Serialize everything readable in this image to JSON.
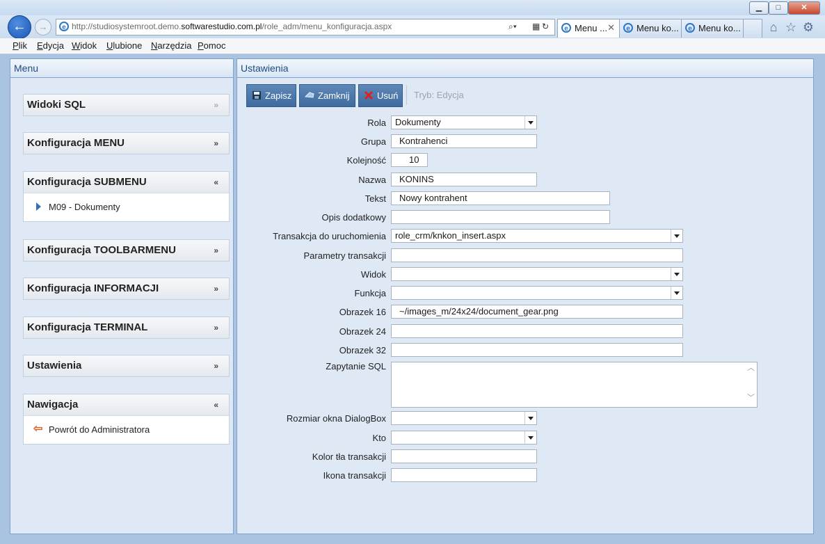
{
  "browser": {
    "url_prefix": "http://studiosystemroot.demo.",
    "url_domain": "softwarestudio.com.pl",
    "url_path": "/role_adm/menu_konfiguracja.aspx",
    "search_icon": "search-icon",
    "tabs": [
      {
        "label": "Menu ...",
        "active": true
      },
      {
        "label": "Menu ko...",
        "active": false
      },
      {
        "label": "Menu ko...",
        "active": false
      }
    ],
    "close_glyph": "✕",
    "titlebar_buttons": {
      "minimize": "▁",
      "maximize": "□",
      "close": "✕"
    }
  },
  "menubar": [
    "Plik",
    "Edycja",
    "Widok",
    "Ulubione",
    "Narzędzia",
    "Pomoc"
  ],
  "sidebar": {
    "title": "Menu",
    "sections": [
      {
        "title": "Widoki SQL",
        "expanded": false,
        "dim": true
      },
      {
        "title": "Konfiguracja MENU",
        "expanded": false
      },
      {
        "title": "Konfiguracja SUBMENU",
        "expanded": true,
        "item": "M09 - Dokumenty"
      },
      {
        "title": "Konfiguracja TOOLBARMENU",
        "expanded": false
      },
      {
        "title": "Konfiguracja INFORMACJI",
        "expanded": false
      },
      {
        "title": "Konfiguracja TERMINAL",
        "expanded": false
      },
      {
        "title": "Ustawienia",
        "expanded": false
      },
      {
        "title": "Nawigacja",
        "expanded": true,
        "item": "Powrót do Administratora"
      }
    ]
  },
  "main": {
    "title": "Ustawienia",
    "toolbar": {
      "save": "Zapisz",
      "close": "Zamknij",
      "delete": "Usuń",
      "mode": "Tryb: Edycja"
    },
    "form": {
      "rola": {
        "label": "Rola",
        "value": "Dokumenty"
      },
      "grupa": {
        "label": "Grupa",
        "value": "Kontrahenci"
      },
      "kolejnosc": {
        "label": "Kolejność",
        "value": "10"
      },
      "nazwa": {
        "label": "Nazwa",
        "value": "KONINS"
      },
      "tekst": {
        "label": "Tekst",
        "value": "Nowy kontrahent"
      },
      "opis": {
        "label": "Opis dodatkowy",
        "value": ""
      },
      "transakcja": {
        "label": "Transakcja do uruchomienia",
        "value": "role_crm/knkon_insert.aspx"
      },
      "parametry": {
        "label": "Parametry transakcji",
        "value": ""
      },
      "widok": {
        "label": "Widok",
        "value": ""
      },
      "funkcja": {
        "label": "Funkcja",
        "value": ""
      },
      "obrazek16": {
        "label": "Obrazek 16",
        "value": "~/images_m/24x24/document_gear.png"
      },
      "obrazek24": {
        "label": "Obrazek 24",
        "value": ""
      },
      "obrazek32": {
        "label": "Obrazek 32",
        "value": ""
      },
      "sql": {
        "label": "Zapytanie SQL",
        "value": ""
      },
      "rozmiar": {
        "label": "Rozmiar okna DialogBox",
        "value": ""
      },
      "kto": {
        "label": "Kto",
        "value": ""
      },
      "kolor": {
        "label": "Kolor tła transakcji",
        "value": ""
      },
      "ikona": {
        "label": "Ikona transakcji",
        "value": ""
      }
    }
  }
}
